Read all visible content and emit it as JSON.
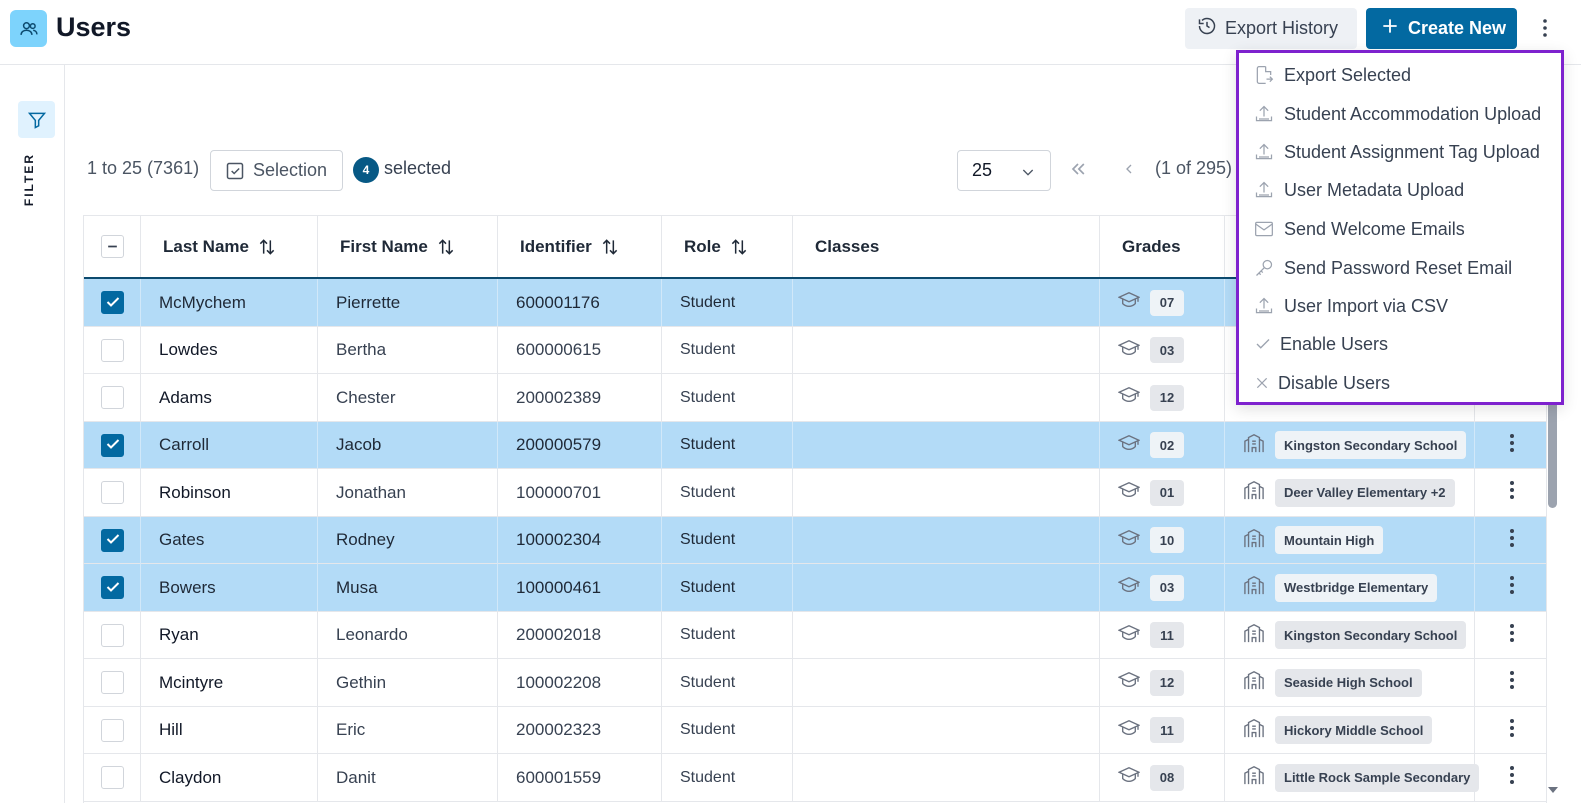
{
  "header": {
    "title": "Users",
    "export_history_label": "Export History",
    "create_new_label": "Create New"
  },
  "sidebar": {
    "filter_label": "FILTER"
  },
  "toolbar": {
    "range_text": "1 to 25 (7361)",
    "selection_label": "Selection",
    "selected_count": "4",
    "selected_label": "selected",
    "page_size": "25",
    "page_info": "(1 of 295)"
  },
  "table": {
    "columns": [
      "Last Name",
      "First Name",
      "Identifier",
      "Role",
      "Classes",
      "Grades"
    ],
    "rows": [
      {
        "last": "McMychem",
        "first": "Pierrette",
        "id": "600001176",
        "role": "Student",
        "grade": "07",
        "school": "",
        "selected": true
      },
      {
        "last": "Lowdes",
        "first": "Bertha",
        "id": "600000615",
        "role": "Student",
        "grade": "03",
        "school": "",
        "selected": false
      },
      {
        "last": "Adams",
        "first": "Chester",
        "id": "200002389",
        "role": "Student",
        "grade": "12",
        "school": "",
        "selected": false
      },
      {
        "last": "Carroll",
        "first": "Jacob",
        "id": "200000579",
        "role": "Student",
        "grade": "02",
        "school": "Kingston Secondary School",
        "selected": true
      },
      {
        "last": "Robinson",
        "first": "Jonathan",
        "id": "100000701",
        "role": "Student",
        "grade": "01",
        "school": "Deer Valley Elementary +2",
        "selected": false
      },
      {
        "last": "Gates",
        "first": "Rodney",
        "id": "100002304",
        "role": "Student",
        "grade": "10",
        "school": "Mountain High",
        "selected": true
      },
      {
        "last": "Bowers",
        "first": "Musa",
        "id": "100000461",
        "role": "Student",
        "grade": "03",
        "school": "Westbridge Elementary",
        "selected": true
      },
      {
        "last": "Ryan",
        "first": "Leonardo",
        "id": "200002018",
        "role": "Student",
        "grade": "11",
        "school": "Kingston Secondary School",
        "selected": false
      },
      {
        "last": "Mcintyre",
        "first": "Gethin",
        "id": "100002208",
        "role": "Student",
        "grade": "12",
        "school": "Seaside High School",
        "selected": false
      },
      {
        "last": "Hill",
        "first": "Eric",
        "id": "200002323",
        "role": "Student",
        "grade": "11",
        "school": "Hickory Middle School",
        "selected": false
      },
      {
        "last": "Claydon",
        "first": "Danit",
        "id": "600001559",
        "role": "Student",
        "grade": "08",
        "school": "Little Rock Sample Secondary",
        "selected": false
      }
    ]
  },
  "menu": {
    "items": [
      {
        "label": "Export Selected",
        "icon": "file-export-icon"
      },
      {
        "label": "Student Accommodation Upload",
        "icon": "upload-icon"
      },
      {
        "label": "Student Assignment Tag Upload",
        "icon": "upload-icon"
      },
      {
        "label": "User Metadata Upload",
        "icon": "upload-icon"
      },
      {
        "label": "Send Welcome Emails",
        "icon": "envelope-icon"
      },
      {
        "label": "Send Password Reset Email",
        "icon": "key-icon"
      },
      {
        "label": "User Import via CSV",
        "icon": "upload-icon"
      },
      {
        "label": "Enable Users",
        "icon": "check-icon"
      },
      {
        "label": "Disable Users",
        "icon": "x-icon"
      }
    ]
  },
  "colors": {
    "primary": "#0369a1",
    "selected_row": "#b3dbf7",
    "menu_border": "#7e22ce",
    "app_icon_bg": "#7dd3fc"
  }
}
